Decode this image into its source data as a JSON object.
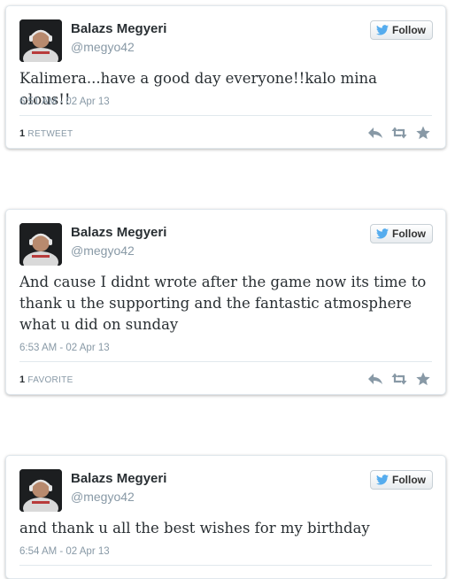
{
  "tweets": [
    {
      "name": "Balazs Megyeri",
      "handle": "@megyo42",
      "follow_label": "Follow",
      "text": "Kalimera...have a good day everyone!!kalo mina olous!!",
      "timestamp": "6:51 AM - 02 Apr 13",
      "stat_count": "1",
      "stat_label": "RETWEET"
    },
    {
      "name": "Balazs Megyeri",
      "handle": "@megyo42",
      "follow_label": "Follow",
      "text": "And cause I didnt wrote after the game now its time to thank u the supporting and the fantastic atmosphere what u did on sunday",
      "timestamp": "6:53 AM - 02 Apr 13",
      "stat_count": "1",
      "stat_label": "FAVORITE"
    },
    {
      "name": "Balazs Megyeri",
      "handle": "@megyo42",
      "follow_label": "Follow",
      "text": "and thank u all the best wishes for my birthday",
      "timestamp": "6:54 AM - 02 Apr 13"
    }
  ],
  "icons": {
    "follow": "twitter-bird-icon",
    "reply": "reply-icon",
    "retweet": "retweet-icon",
    "favorite": "star-icon"
  },
  "colors": {
    "twitter_blue": "#55acee",
    "text": "#292f33",
    "muted": "#8899a6",
    "action_icon": "#8899a6"
  }
}
